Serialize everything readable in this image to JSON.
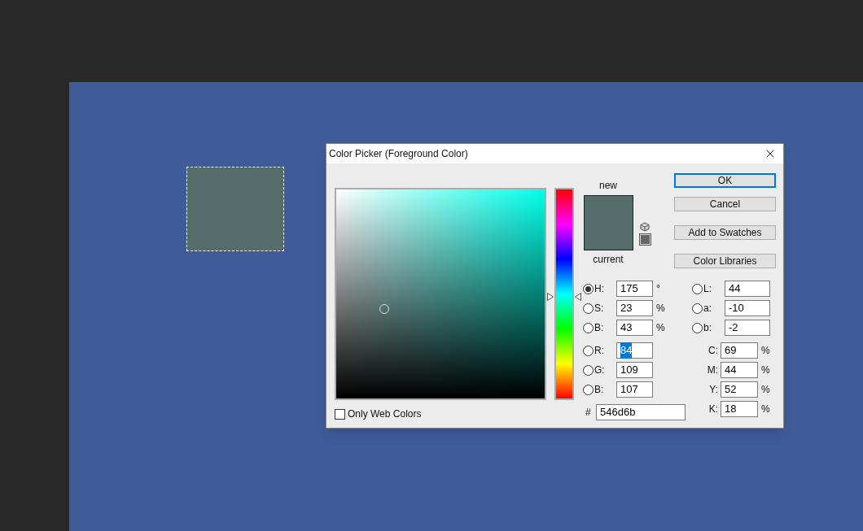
{
  "window": {
    "title": "Color Picker (Foreground Color)"
  },
  "preview": {
    "new_label": "new",
    "current_label": "current"
  },
  "buttons": [
    {
      "label": "OK",
      "default": true
    },
    {
      "label": "Cancel",
      "default": false
    },
    {
      "label": "Add to Swatches",
      "default": false
    },
    {
      "label": "Color Libraries",
      "default": false
    }
  ],
  "hue_slider": {
    "level": 0.486
  },
  "only_web_colors": {
    "label": "Only Web Colors",
    "checked": false
  },
  "hsb": [
    {
      "label": "H:",
      "value": "175",
      "unit": "°",
      "selected": true,
      "text_selected": false
    },
    {
      "label": "S:",
      "value": "23",
      "unit": "%",
      "selected": false,
      "text_selected": false
    },
    {
      "label": "B:",
      "value": "43",
      "unit": "%",
      "selected": false,
      "text_selected": false
    }
  ],
  "rgb": [
    {
      "label": "R:",
      "value": "84",
      "selected": false,
      "text_selected": true
    },
    {
      "label": "G:",
      "value": "109",
      "selected": false,
      "text_selected": false
    },
    {
      "label": "B:",
      "value": "107",
      "selected": false,
      "text_selected": false
    }
  ],
  "hex": {
    "label": "#",
    "value": "546d6b"
  },
  "lab": [
    {
      "label": "L:",
      "value": "44",
      "selected": false,
      "text_selected": false
    },
    {
      "label": "a:",
      "value": "-10",
      "selected": false,
      "text_selected": false
    },
    {
      "label": "b:",
      "value": "-2",
      "selected": false,
      "text_selected": false
    }
  ],
  "cmyk": [
    {
      "label": "C:",
      "value": "69",
      "unit": "%",
      "text_selected": false
    },
    {
      "label": "M:",
      "value": "44",
      "unit": "%",
      "text_selected": false
    },
    {
      "label": "Y:",
      "value": "52",
      "unit": "%",
      "text_selected": false
    },
    {
      "label": "K:",
      "value": "18",
      "unit": "%",
      "text_selected": false
    }
  ]
}
